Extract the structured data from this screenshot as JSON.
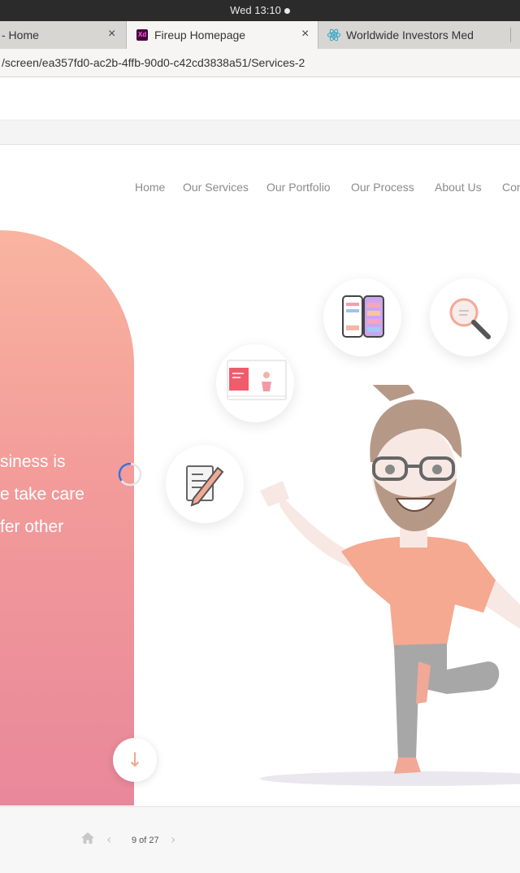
{
  "system": {
    "clock": "Wed 13:10"
  },
  "tabs": [
    {
      "title": "- Home",
      "close": "×"
    },
    {
      "title": "Fireup Homepage",
      "close": "×",
      "icon": "adobe-xd-icon"
    },
    {
      "title": "Worldwide Investors Med",
      "close": "",
      "icon": "react-icon"
    }
  ],
  "address": {
    "url": "/screen/ea357fd0-ac2b-4ffb-90d0-c42cd3838a51/Services-2"
  },
  "nav": {
    "items": [
      "Home",
      "Our Services",
      "Our Portfolio",
      "Our Process",
      "About Us",
      "Cor"
    ]
  },
  "hero": {
    "lines": [
      "siness is",
      "e take care",
      "fer other"
    ],
    "down_arrow": "↓",
    "gradient_top": "#f9b4a0",
    "gradient_bottom": "#e8869a"
  },
  "viewer": {
    "page_indicator": "9 of 27",
    "prev": "‹",
    "next": "›"
  },
  "colors": {
    "accent": "#f4a58e",
    "nav_text": "#8b8b8b"
  }
}
